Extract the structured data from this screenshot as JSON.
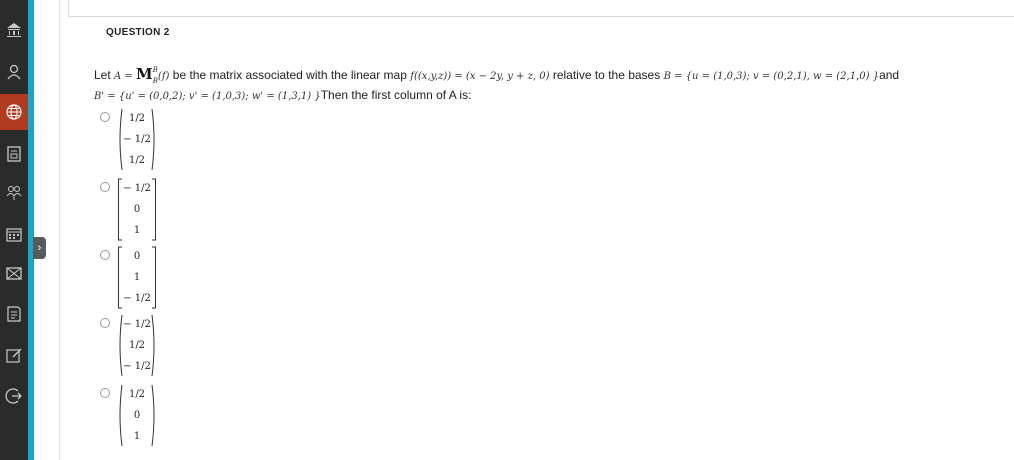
{
  "question": {
    "heading": "QUESTION 2",
    "line1": {
      "let": "Let",
      "a_eq": "A = ",
      "M": "M",
      "sup": "B",
      "sub": "B",
      "f_arg": "(f)",
      "be_matrix": "be the matrix associated with the linear map",
      "map_expr": "f((x,y,z)) = (x − 2y, y + z, 0)",
      "relative": "relative to the bases",
      "basis_B": "B = {u = (1,0,3); v = (0,2,1), w = (2,1,0) }",
      "and": "and"
    },
    "line2": {
      "basis_B2": "B' = {u' = (0,0,2); v' = (1,0,3); w' = (1,3,1) }",
      "then": "Then the first column of A is:"
    }
  },
  "options": [
    {
      "bracket": "round",
      "entries": [
        "1/2",
        "− 1/2",
        "1/2"
      ]
    },
    {
      "bracket": "square",
      "entries": [
        "− 1/2",
        "0",
        "1"
      ]
    },
    {
      "bracket": "square",
      "entries": [
        "0",
        "1",
        "− 1/2"
      ]
    },
    {
      "bracket": "round",
      "entries": [
        "− 1/2",
        "1/2",
        "− 1/2"
      ]
    },
    {
      "bracket": "round",
      "entries": [
        "1/2",
        "0",
        "1"
      ]
    }
  ],
  "nav": {
    "icons": [
      "institution-icon",
      "user-icon",
      "globe-icon",
      "courses-icon",
      "groups-icon",
      "calendar-icon",
      "messages-icon",
      "grades-icon",
      "tools-icon",
      "sign-out-icon"
    ],
    "expander_glyph": "›",
    "colors": {
      "bar": "#2b2b2b",
      "accent": "#17a6c9",
      "active": "#b23a1e"
    }
  }
}
